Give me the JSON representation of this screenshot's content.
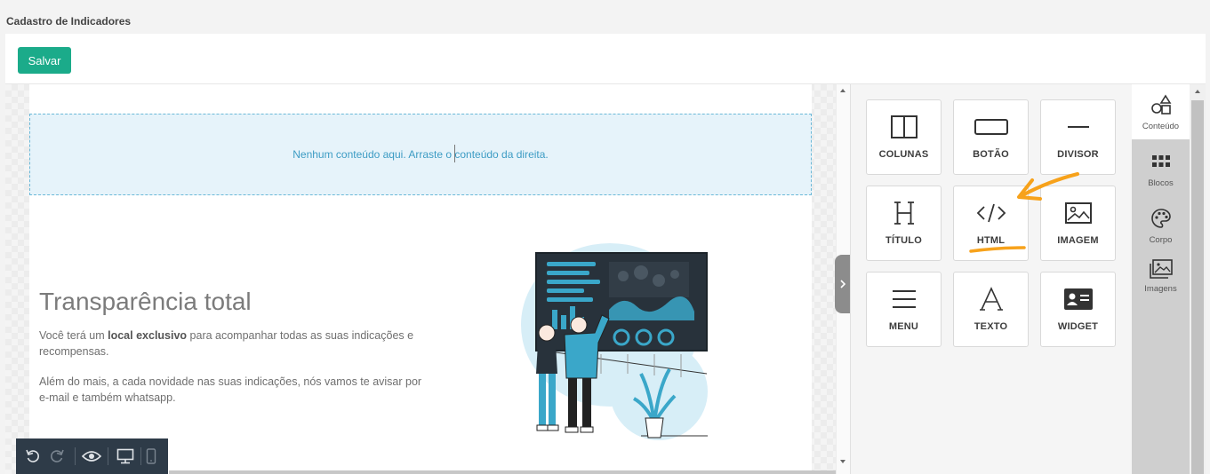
{
  "page": {
    "title": "Cadastro de Indicadores"
  },
  "toolbar": {
    "save_label": "Salvar",
    "save_color": "#1bab8a"
  },
  "canvas": {
    "dropzone_text": "Nenhum conteúdo aqui. Arraste o conteúdo da direita.",
    "hero": {
      "title": "Transparência total",
      "p1_before": "Você terá um ",
      "p1_bold": "local exclusivo",
      "p1_after": " para acompanhar todas as  suas indicações e recompensas.",
      "p2": "Além do mais, a cada novidade nas suas indicações, nós vamos te avisar por e-mail e também whatsapp."
    }
  },
  "editor_actions": {
    "icons": [
      "undo-icon",
      "redo-icon",
      "eye-icon",
      "desktop-icon",
      "mobile-icon"
    ]
  },
  "tools": [
    {
      "label": "COLUNAS",
      "icon": "columns-icon"
    },
    {
      "label": "BOTÃO",
      "icon": "button-icon"
    },
    {
      "label": "DIVISOR",
      "icon": "divider-icon"
    },
    {
      "label": "TÍTULO",
      "icon": "heading-icon"
    },
    {
      "label": "HTML",
      "icon": "code-icon"
    },
    {
      "label": "IMAGEM",
      "icon": "image-icon"
    },
    {
      "label": "MENU",
      "icon": "menu-icon"
    },
    {
      "label": "TEXTO",
      "icon": "text-icon"
    },
    {
      "label": "WIDGET",
      "icon": "widget-icon"
    }
  ],
  "tabs": [
    {
      "label": "Conteúdo",
      "icon": "shapes-icon",
      "active": true
    },
    {
      "label": "Blocos",
      "icon": "grid-icon",
      "active": false
    },
    {
      "label": "Corpo",
      "icon": "palette-icon",
      "active": false
    },
    {
      "label": "Imagens",
      "icon": "images-icon",
      "active": false
    }
  ],
  "colors": {
    "accent": "#1bab8a",
    "annotation": "#f7a21b",
    "illustration": "#3aa7c9"
  }
}
